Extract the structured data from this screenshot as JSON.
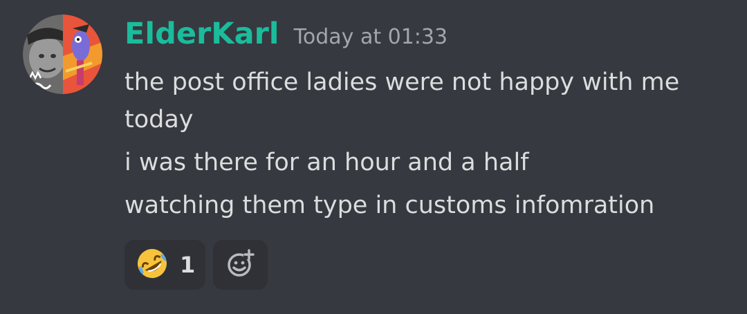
{
  "message": {
    "author": "ElderKarl",
    "timestamp": "Today at 01:33",
    "lines": [
      "the post office ladies were not happy with me today",
      "i was there for an hour and a half",
      "watching them type in customs infomration"
    ],
    "reactions": [
      {
        "emoji": "rolling-on-the-floor-laughing",
        "count": "1"
      }
    ]
  },
  "icons": {
    "reaction": "rofl-emoji-icon",
    "add_reaction": "add-reaction-icon"
  },
  "colors": {
    "background": "#36393f",
    "username": "#1abc9c",
    "timestamp": "#a3a6aa",
    "text": "#dcddde",
    "reaction_bg": "#2f3136"
  }
}
